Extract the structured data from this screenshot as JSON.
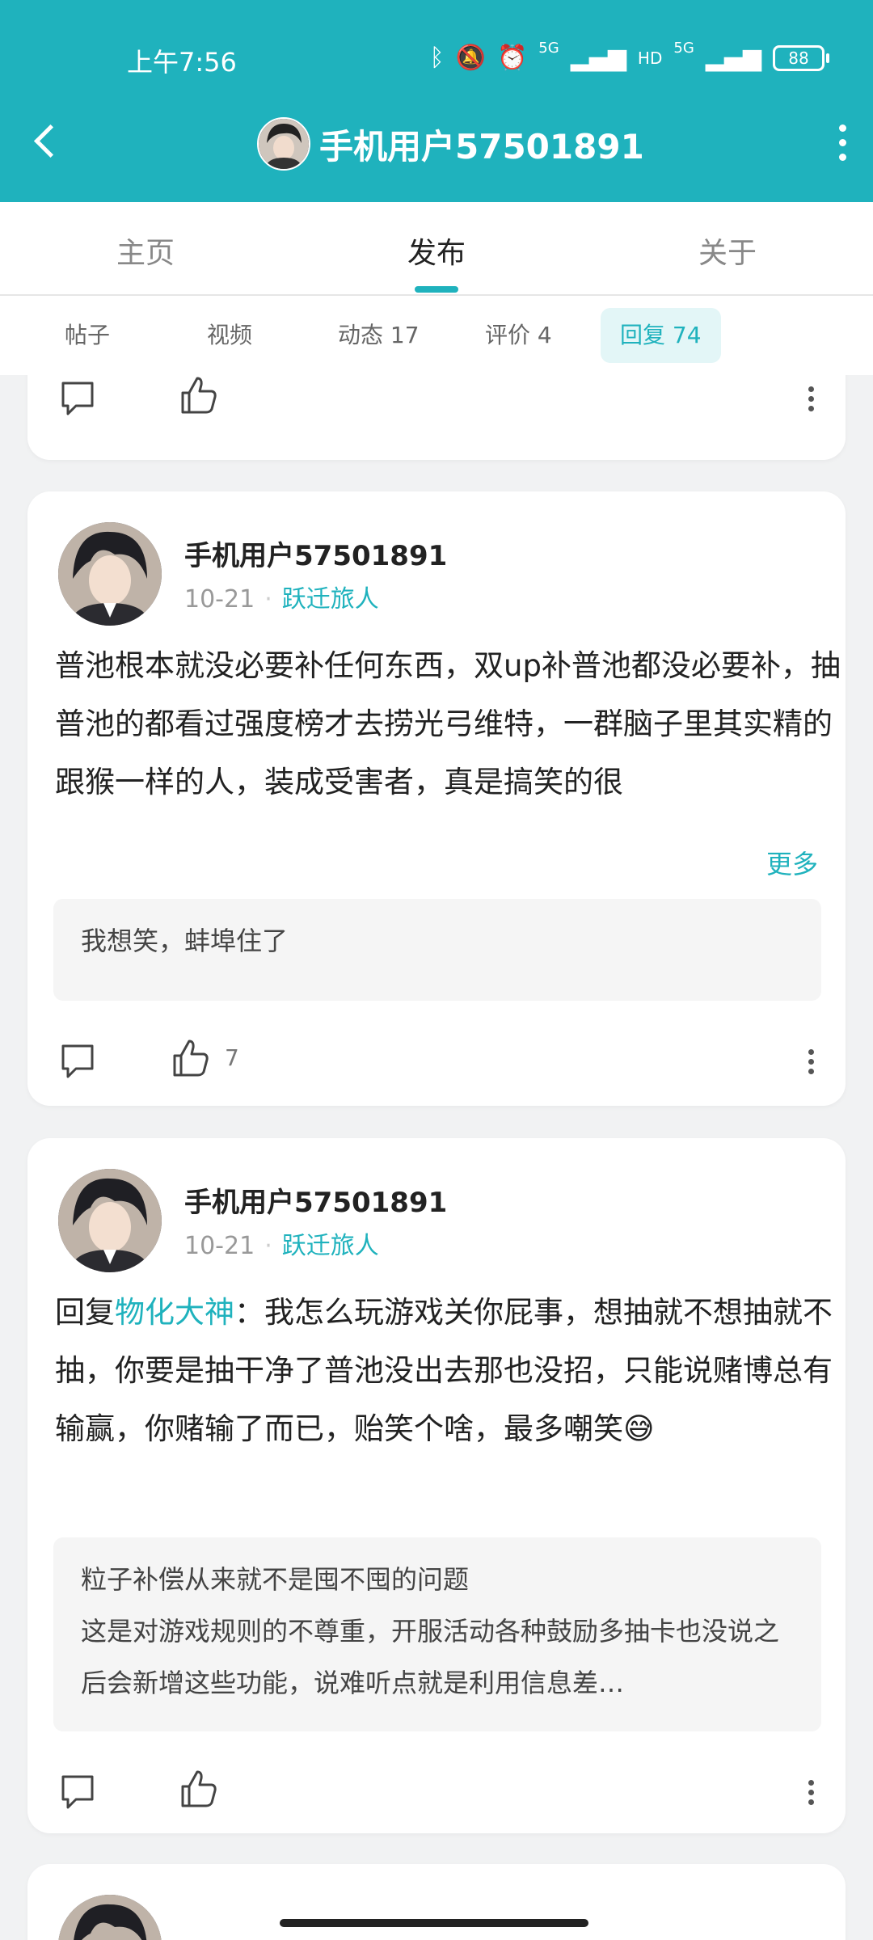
{
  "status_bar": {
    "time": "上午7:56",
    "battery": "88",
    "net1": "5G",
    "net2": "5G"
  },
  "header": {
    "title": "手机用户57501891"
  },
  "tabs": [
    {
      "label": "主页"
    },
    {
      "label": "发布"
    },
    {
      "label": "关于"
    }
  ],
  "sub_tabs": [
    {
      "label": "帖子"
    },
    {
      "label": "视频"
    },
    {
      "label": "动态 17"
    },
    {
      "label": "评价 4"
    },
    {
      "label": "回复 74"
    }
  ],
  "posts": [
    {
      "author": "手机用户57501891",
      "date": "10-21",
      "badge": "跃迁旅人",
      "content": "普池根本就没必要补任何东西，双up补普池都没必要补，抽普池的都看过强度榜才去捞光弓维特，一群脑子里其实精的跟猴一样的人，装成受害者，真是搞笑的很",
      "more": "更多",
      "quote": "我想笑，蚌埠住了",
      "likes": "7"
    },
    {
      "author": "手机用户57501891",
      "date": "10-21",
      "badge": "跃迁旅人",
      "reply_prefix": "回复",
      "reply_to": "物化大神",
      "content": "：我怎么玩游戏关你屁事，想抽就不想抽就不抽，你要是抽干净了普池没出去那也没招，只能说赌博总有输赢，你赌输了而已，贻笑个啥，最多嘲笑😅",
      "quote_line1": "粒子补偿从来就不是囤不囤的问题",
      "quote_line2": "这是对游戏规则的不尊重，开服活动各种鼓励多抽卡也没说之后会新增这些功能，说难听点就是利用信息差…"
    }
  ]
}
